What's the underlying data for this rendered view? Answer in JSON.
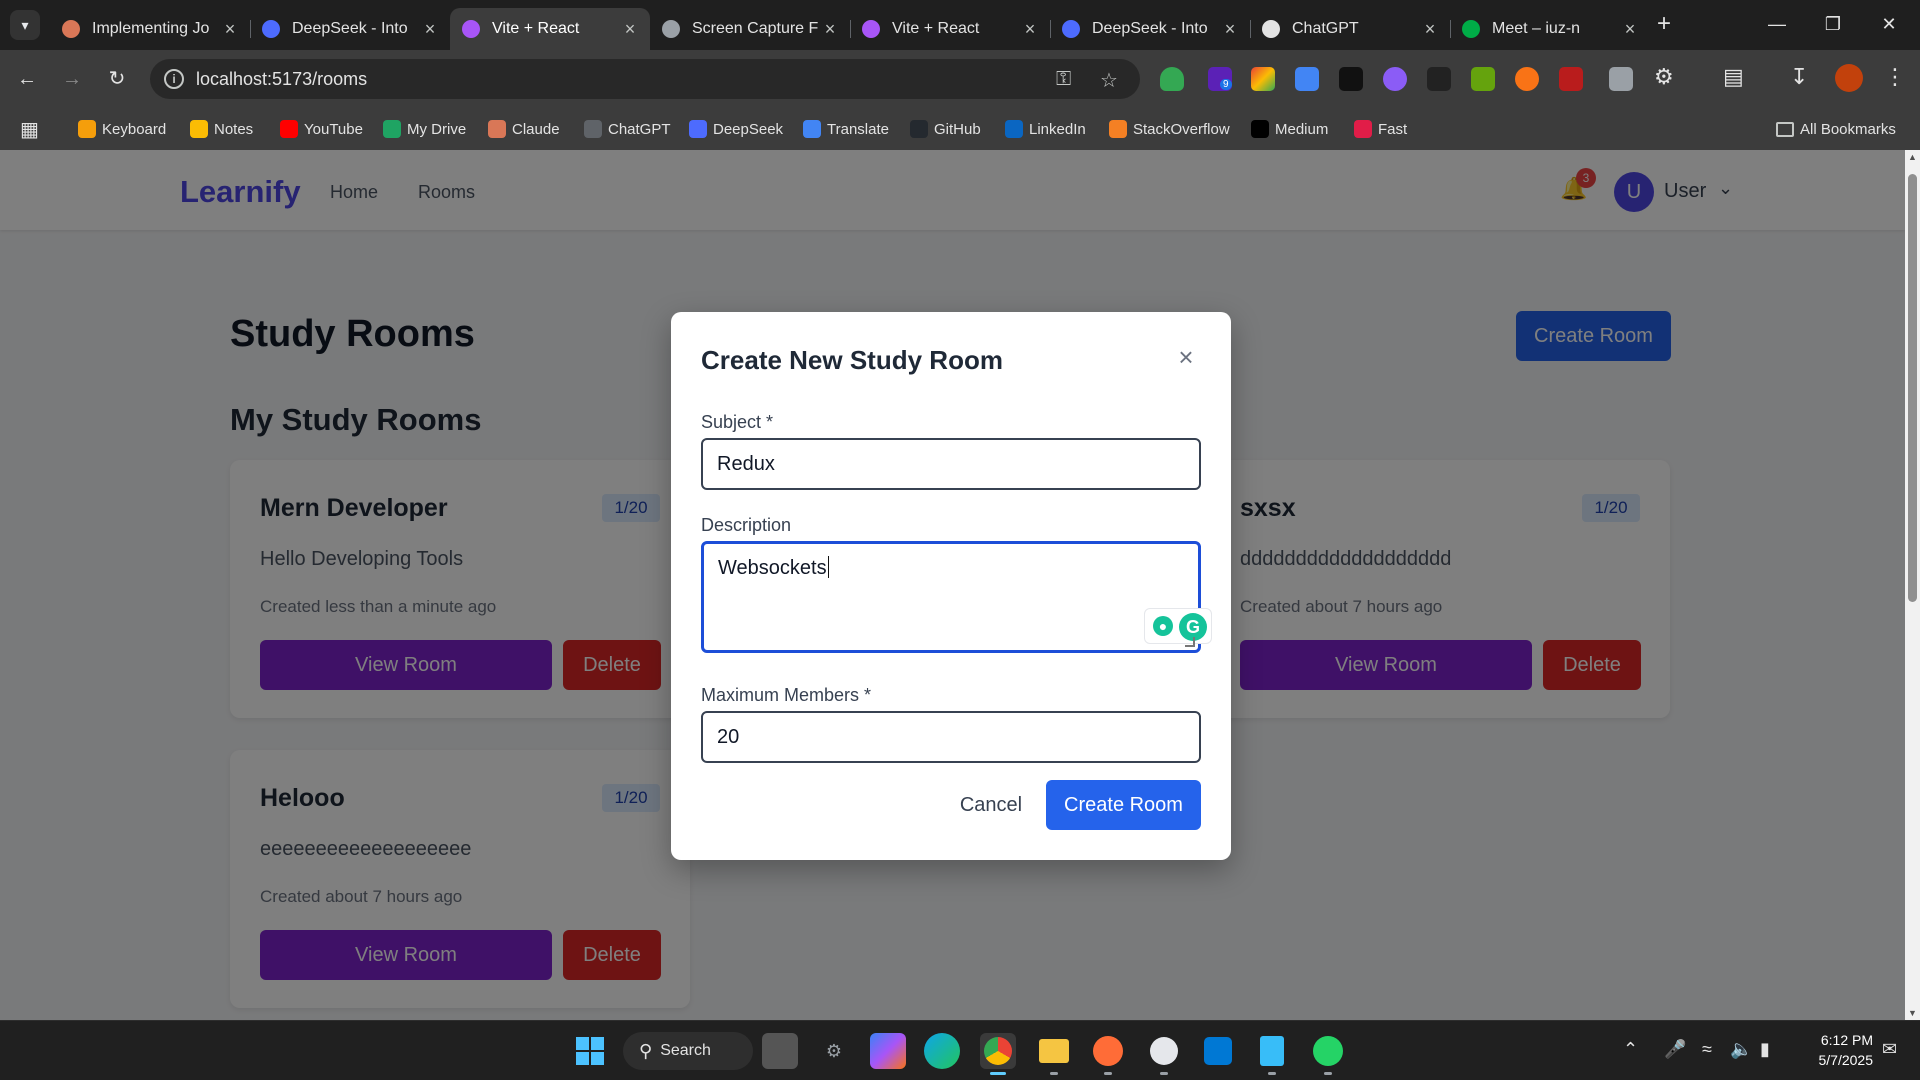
{
  "browser": {
    "tabs": [
      {
        "title": "Implementing Jo",
        "icon": "claude-icon",
        "color": "#d97757"
      },
      {
        "title": "DeepSeek - Into",
        "icon": "deepseek-icon",
        "color": "#4d6bfe"
      },
      {
        "title": "Vite + React",
        "icon": "vite-icon",
        "color": "#a855f7",
        "active": true
      },
      {
        "title": "Screen Capture F",
        "icon": "camera-icon",
        "color": "#9aa0a6"
      },
      {
        "title": "Vite + React",
        "icon": "vite-icon",
        "color": "#a855f7"
      },
      {
        "title": "DeepSeek - Into",
        "icon": "deepseek-icon",
        "color": "#4d6bfe"
      },
      {
        "title": "ChatGPT",
        "icon": "chatgpt-icon",
        "color": "#e3e3e3"
      },
      {
        "title": "Meet – iuz-n",
        "icon": "meet-icon",
        "color": "#00ac47"
      }
    ],
    "url": "localhost:5173/rooms",
    "bookmarks": [
      {
        "label": "Keyboard",
        "color": "#f59e0b"
      },
      {
        "label": "Notes",
        "color": "#fbbc04"
      },
      {
        "label": "YouTube",
        "color": "#ff0000"
      },
      {
        "label": "My Drive",
        "color": "#1fa463"
      },
      {
        "label": "Claude",
        "color": "#d97757"
      },
      {
        "label": "ChatGPT",
        "color": "#5f6368"
      },
      {
        "label": "DeepSeek",
        "color": "#4d6bfe"
      },
      {
        "label": "Translate",
        "color": "#4285f4"
      },
      {
        "label": "GitHub",
        "color": "#24292f"
      },
      {
        "label": "LinkedIn",
        "color": "#0a66c2"
      },
      {
        "label": "StackOverflow",
        "color": "#f48024"
      },
      {
        "label": "Medium",
        "color": "#000000"
      },
      {
        "label": "Fast",
        "color": "#e11d48"
      }
    ],
    "all_bookmarks": "All Bookmarks",
    "extension_badge": "9"
  },
  "app": {
    "brand": "Learnify",
    "nav": {
      "home": "Home",
      "rooms": "Rooms"
    },
    "notification_count": "3",
    "user_initial": "U",
    "user_name": "User",
    "page_title": "Study Rooms",
    "create_room_button": "Create Room",
    "section_title": "My Study Rooms",
    "view_room_label": "View Room",
    "delete_label": "Delete",
    "rooms": [
      {
        "name": "Mern Developer",
        "members": "1/20",
        "description": "Hello Developing Tools",
        "created": "Created less than a minute ago"
      },
      {
        "name": "sxsx",
        "members": "1/20",
        "description": "ddddddddddddddddddd",
        "created": "Created about 7 hours ago"
      },
      {
        "name": "Helooo",
        "members": "1/20",
        "description": "eeeeeeeeeeeeeeeeeee",
        "created": "Created about 7 hours ago"
      }
    ]
  },
  "modal": {
    "title": "Create New Study Room",
    "close_symbol": "×",
    "subject_label": "Subject *",
    "subject_value": "Redux",
    "description_label": "Description",
    "description_value": "Websockets",
    "max_members_label": "Maximum Members *",
    "max_members_value": "20",
    "cancel_label": "Cancel",
    "submit_label": "Create Room"
  },
  "taskbar": {
    "search_label": "Search",
    "time": "6:12 PM",
    "date": "5/7/2025"
  },
  "colors": {
    "brand": "#4f46e5",
    "primary": "#2563eb",
    "view_button": "#7e22ce",
    "delete_button": "#dc2626",
    "badge_bg": "#dbeafe"
  }
}
